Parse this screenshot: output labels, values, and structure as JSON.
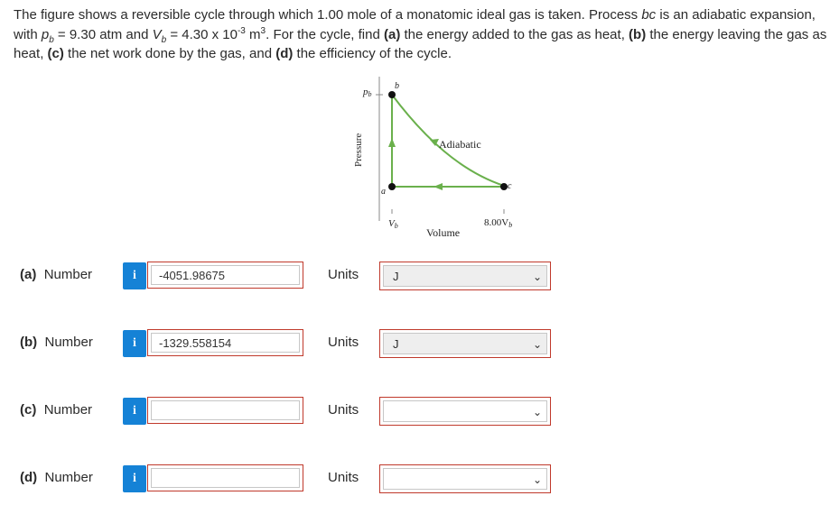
{
  "problem": {
    "part1": "The figure shows a reversible cycle through which 1.00 mole of a monatomic ideal gas is taken. Process ",
    "bc": "bc",
    "part2": " is an adiabatic expansion, with ",
    "pb_sym": "p",
    "pb_sub": "b",
    "pb_val": " = 9.30 atm and ",
    "vb_sym": "V",
    "vb_sub": "b",
    "vb_val": " = 4.30 x 10",
    "vb_exp": "-3",
    "vb_unit": " m",
    "vb_unit_exp": "3",
    "part3": ". For the cycle, find ",
    "a_lbl": "(a)",
    "a_text": " the energy added to the gas as heat, ",
    "b_lbl": "(b)",
    "b_text": " the energy leaving the gas as heat, ",
    "c_lbl": "(c)",
    "c_text": " the net work done by the gas, and ",
    "d_lbl": "(d)",
    "d_text": " the efficiency of the cycle."
  },
  "figure": {
    "pb_label": "p",
    "pb_sub": "b",
    "b_point": "b",
    "a_point": "a",
    "c_point": "c",
    "adiabatic": "Adiabatic",
    "ylabel": "Pressure",
    "xlabel": "Volume",
    "vb_tick": "V",
    "vb_tick_sub": "b",
    "vc_tick": "8.00V",
    "vc_tick_sub": "b",
    "curve_color": "#6ab04c"
  },
  "questions": [
    {
      "part": "(a)",
      "label": "Number",
      "info": "i",
      "value": "-4051.98675",
      "units_label": "Units",
      "unit": "J"
    },
    {
      "part": "(b)",
      "label": "Number",
      "info": "i",
      "value": "-1329.558154",
      "units_label": "Units",
      "unit": "J"
    },
    {
      "part": "(c)",
      "label": "Number",
      "info": "i",
      "value": "",
      "units_label": "Units",
      "unit": ""
    },
    {
      "part": "(d)",
      "label": "Number",
      "info": "i",
      "value": "",
      "units_label": "Units",
      "unit": ""
    }
  ]
}
